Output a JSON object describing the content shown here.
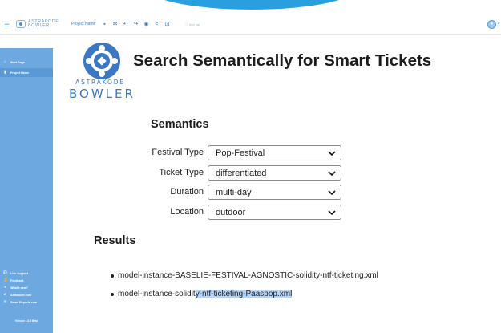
{
  "topbar": {
    "brand": "ASTRAKODE",
    "brand_sub": "BOWLER",
    "project_name": "Project Name",
    "info_label": "Info bar"
  },
  "sidebar": {
    "items": [
      {
        "label": "Start Page",
        "icon": "home-icon"
      },
      {
        "label": "Project Name",
        "icon": "file-icon"
      }
    ],
    "bottom_items": [
      {
        "label": "Live Support",
        "icon": "headset-icon"
      },
      {
        "label": "Feedback",
        "icon": "thumbs-up-icon"
      },
      {
        "label": "What's new?",
        "icon": "megaphone-icon"
      },
      {
        "label": "Astrakode.com",
        "icon": "rocket-icon"
      },
      {
        "label": "Smart Reports.com",
        "icon": "infinity-icon"
      }
    ],
    "version": "Version 1.0.3 Beta"
  },
  "logo": {
    "line1": "ASTRAKODE",
    "line2": "BOWLER"
  },
  "main": {
    "title": "Search Semantically for Smart Tickets",
    "semantics_heading": "Semantics",
    "fields": [
      {
        "label": "Festival Type",
        "value": "Pop-Festival"
      },
      {
        "label": "Ticket Type",
        "value": "differentiated"
      },
      {
        "label": "Duration",
        "value": "multi-day"
      },
      {
        "label": "Location",
        "value": "outdoor"
      }
    ],
    "results_heading": "Results",
    "results": [
      {
        "text": "model-instance-BASELIE-FESTIVAL-AGNOSTIC-solidity-ntf-ticketing.xml"
      },
      {
        "text_plain": "model-instance-solidit",
        "text_highlight": "y-ntf-ticketing-Paaspop.xml"
      }
    ]
  },
  "colors": {
    "accent": "#2a9fe0",
    "sidebar": "#6ea8e0",
    "brand": "#3b78c4",
    "highlight": "#b4d5f7"
  }
}
